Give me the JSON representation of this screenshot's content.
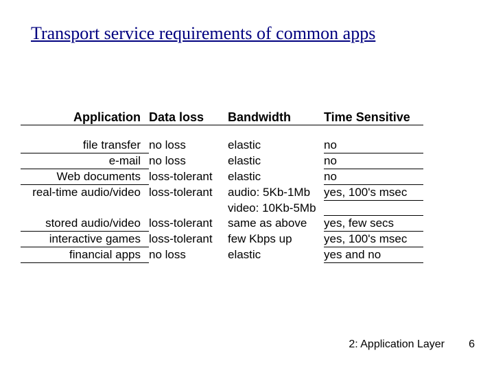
{
  "title": "Transport service requirements of common apps",
  "headers": {
    "app": "Application",
    "loss": "Data loss",
    "bw": "Bandwidth",
    "ts": "Time Sensitive"
  },
  "rows": [
    {
      "app": "file transfer",
      "loss": "no loss",
      "bw": "elastic",
      "ts": "no"
    },
    {
      "app": "e-mail",
      "loss": "no loss",
      "bw": "elastic",
      "ts": "no"
    },
    {
      "app": "Web documents",
      "loss": "loss-tolerant",
      "bw": "elastic",
      "ts": "no"
    },
    {
      "app": "real-time audio/video",
      "loss": "loss-tolerant",
      "bw": "audio: 5Kb-1Mb",
      "ts": "yes, 100's msec"
    },
    {
      "app": "",
      "loss": "",
      "bw": "video: 10Kb-5Mb",
      "ts": ""
    },
    {
      "app": "stored audio/video",
      "loss": "loss-tolerant",
      "bw": "same as above",
      "ts": "yes, few secs"
    },
    {
      "app": "interactive games",
      "loss": "loss-tolerant",
      "bw": "few Kbps up",
      "ts": "yes, 100's msec"
    },
    {
      "app": "financial apps",
      "loss": "no loss",
      "bw": "elastic",
      "ts": "yes and no"
    }
  ],
  "footer": {
    "chapter": "2: Application Layer",
    "page": "6"
  }
}
